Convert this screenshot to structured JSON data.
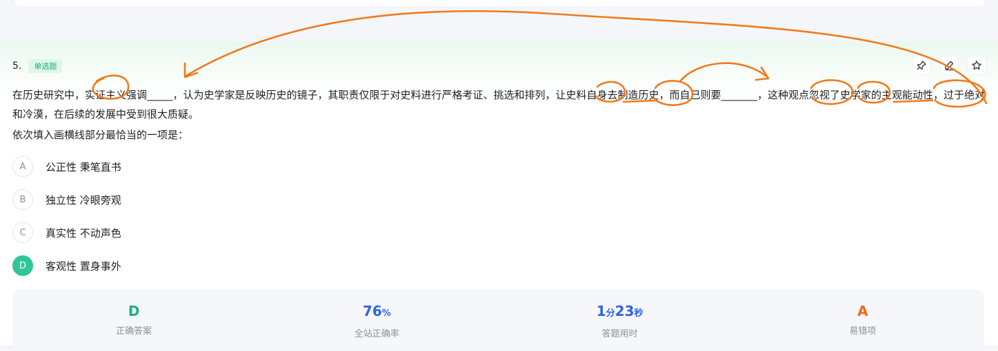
{
  "question": {
    "number": "5.",
    "type_badge": "单选题",
    "stem": "在历史研究中，实证主义强调_____，认为史学家是反映历史的镜子，其职责仅限于对史料进行严格考证、挑选和排列，让史料自身去制造历史，而自己则要_______，这种观点忽视了史学家的主观能动性，过于绝对和冷漠，在后续的发展中受到很大质疑。",
    "prompt": "依次填入画横线部分最恰当的一项是："
  },
  "tools": [
    "pin-icon",
    "edit-icon",
    "star-icon"
  ],
  "options": [
    {
      "letter": "A",
      "text": "公正性 秉笔直书"
    },
    {
      "letter": "B",
      "text": "独立性 冷眼旁观"
    },
    {
      "letter": "C",
      "text": "真实性 不动声色"
    },
    {
      "letter": "D",
      "text": "客观性 置身事外"
    }
  ],
  "stats": {
    "answer": {
      "value": "D",
      "label": "正确答案"
    },
    "accuracy": {
      "value": "76",
      "unit": "%",
      "label": "全站正确率"
    },
    "time": {
      "min": "1",
      "min_unit": "分",
      "sec": "23",
      "sec_unit": "秒",
      "label": "答题用时"
    },
    "easy_wrong": {
      "value": "A",
      "label": "易错项"
    }
  },
  "colors": {
    "accent_green": "#2fc79a",
    "badge_green": "#1fb07a",
    "blue": "#2f62e6",
    "orange": "#f06a19",
    "annotation": "#f07a1a"
  }
}
